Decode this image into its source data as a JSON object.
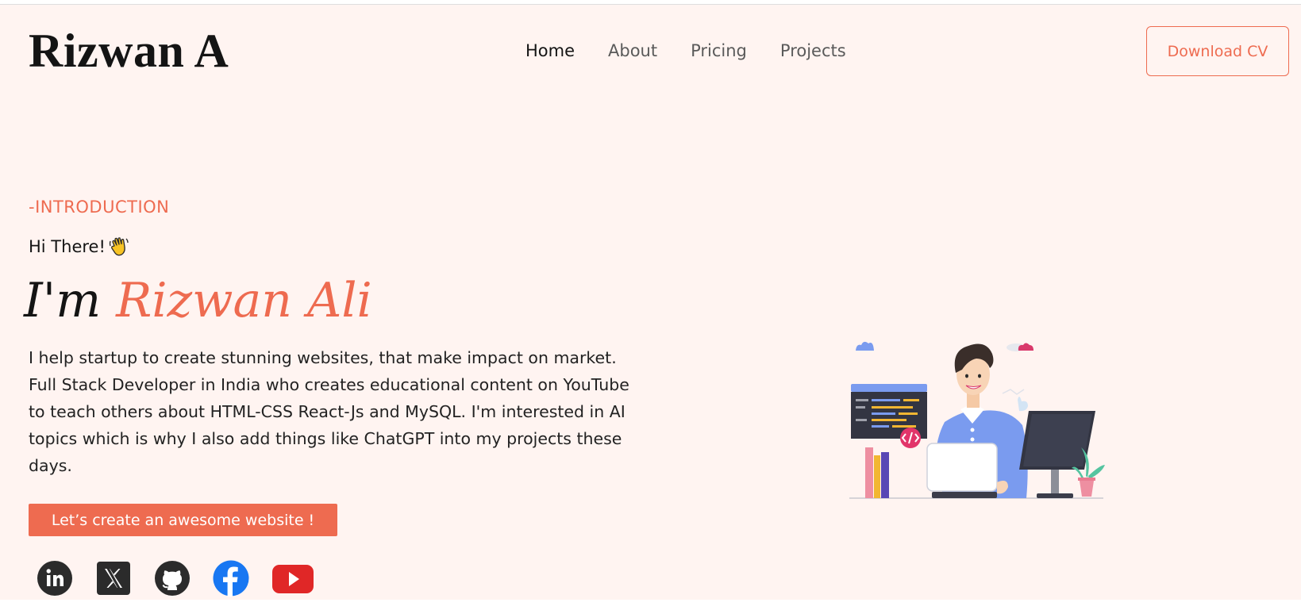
{
  "header": {
    "brand": "Rizwan A",
    "nav": [
      {
        "label": "Home",
        "active": true
      },
      {
        "label": "About",
        "active": false
      },
      {
        "label": "Pricing",
        "active": false
      },
      {
        "label": "Projects",
        "active": false
      }
    ],
    "cv_button": "Download CV"
  },
  "hero": {
    "tag": "-INTRODUCTION",
    "greeting": "Hi There!",
    "greeting_icon": "waving-hand-icon",
    "headline_prefix": "I'm ",
    "headline_name": "Rizwan Ali",
    "description": "I help startup to create stunning websites, that make impact on market. Full Stack Developer in India who creates educational content on YouTube to teach others about HTML-CSS React-Js and MySQL. I'm interested in AI topics which is why I also add things like ChatGPT into my projects these days.",
    "cta": "Let’s create an awesome website !"
  },
  "socials": [
    {
      "icon": "linkedin-icon"
    },
    {
      "icon": "x-icon"
    },
    {
      "icon": "github-icon"
    },
    {
      "icon": "facebook-icon"
    },
    {
      "icon": "youtube-icon"
    }
  ],
  "colors": {
    "accent": "#ee6b50",
    "background": "#fff4f1",
    "text": "#141414"
  }
}
